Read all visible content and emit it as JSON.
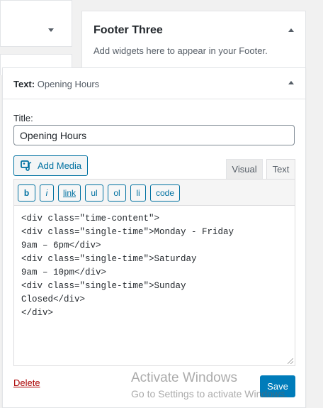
{
  "footer_three": {
    "title": "Footer Three",
    "description": "Add widgets here to appear in your Footer."
  },
  "text_widget": {
    "title_prefix": "Text:",
    "title_name": "Opening Hours",
    "title_label": "Title:",
    "title_value": "Opening Hours",
    "add_media_label": "Add Media",
    "tabs": {
      "visual": "Visual",
      "text": "Text"
    },
    "quicktags": {
      "b": "b",
      "i": "i",
      "link": "link",
      "ul": "ul",
      "ol": "ol",
      "li": "li",
      "code": "code"
    },
    "content_lines": [
      "<div class=\"time-content\">",
      "<div class=\"single-time\">Monday - Friday",
      "9am – 6pm</div>",
      "<div class=\"single-time\">Saturday",
      "9am – 10pm</div>",
      "<div class=\"single-time\">Sunday",
      "Closed</div>",
      "</div>"
    ],
    "delete_label": "Delete",
    "save_label": "Save"
  },
  "watermark": {
    "title": "Activate Windows",
    "subtitle": "Go to Settings to activate Windows."
  },
  "colors": {
    "accent": "#0071a1",
    "primary_button": "#007cba",
    "delete": "#a00000",
    "background": "#f1f1f1"
  }
}
